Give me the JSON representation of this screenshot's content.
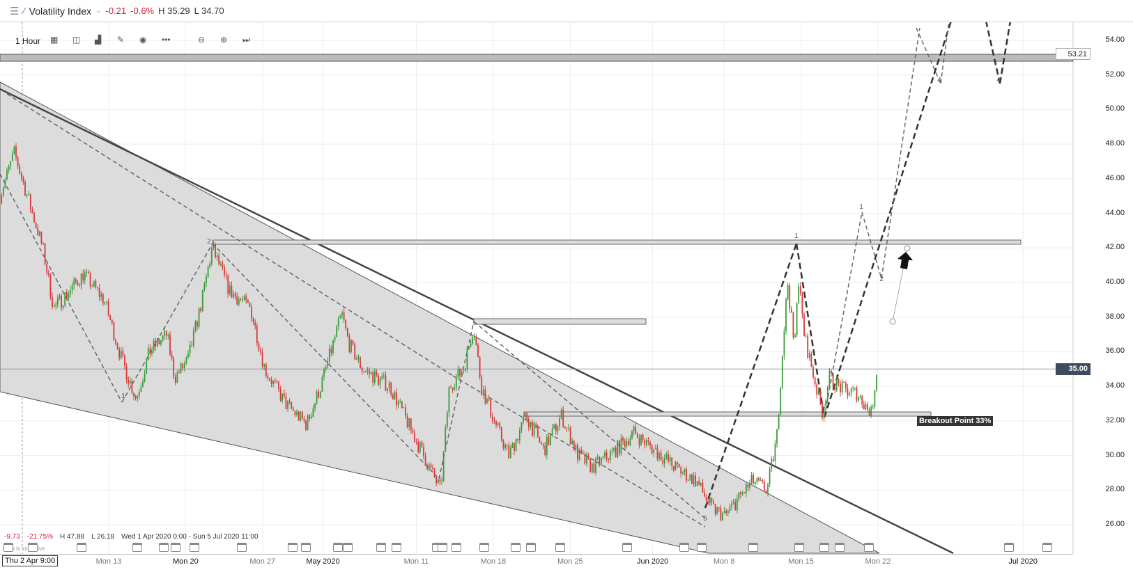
{
  "header": {
    "title": "Volatility Index",
    "change": "-0.21",
    "change_pct": "-0.6%",
    "high": "H 35.29",
    "low": "L 34.70"
  },
  "toolbar": {
    "interval": "1 Hour",
    "icons": [
      "calendar-grid-icon",
      "chart-type-icon",
      "bar-chart-icon",
      "pencil-icon",
      "eye-icon",
      "more-icon",
      "zoom-out-icon",
      "zoom-in-icon",
      "skip-to-end-icon"
    ]
  },
  "footer": {
    "change": "-9.73",
    "change_pct": "-21.75%",
    "high": "H 47.88",
    "low": "L 26.18",
    "range": "Wed 1 Apr 2020 0:00 - Sun 5 Jul 2020 11:00",
    "crosshair_date": "Thu 2 Apr 9:00",
    "disclaimer": "Data is indicative"
  },
  "colors": {
    "up": "#3a9b3a",
    "down": "#d9383a",
    "price_tag": "#3d4b5f"
  },
  "chart_data": {
    "type": "candlestick",
    "ylim": [
      25,
      55
    ],
    "yticks": [
      "54.00",
      "52.00",
      "50.00",
      "48.00",
      "46.00",
      "44.00",
      "42.00",
      "40.00",
      "38.00",
      "36.00",
      "34.00",
      "32.00",
      "30.00",
      "28.00",
      "26.00"
    ],
    "xticks": [
      {
        "d": "2020-04-13 00",
        "label": "Mon 13"
      },
      {
        "d": "2020-04-20 00",
        "label": "Mon 20"
      },
      {
        "d": "2020-04-27 00",
        "label": "Mon 27"
      },
      {
        "d": "2020-05-02 12",
        "label": "May 2020"
      },
      {
        "d": "2020-05-11 00",
        "label": "Mon 11"
      },
      {
        "d": "2020-05-18 00",
        "label": "Mon 18"
      },
      {
        "d": "2020-05-25 00",
        "label": "Mon 25"
      },
      {
        "d": "2020-06-01 12",
        "label": "Jun 2020"
      },
      {
        "d": "2020-06-08 00",
        "label": "Mon 8"
      },
      {
        "d": "2020-06-15 00",
        "label": "Mon 15"
      },
      {
        "d": "2020-06-22 00",
        "label": "Mon 22"
      },
      {
        "d": "2020-07-05 05",
        "label": "Jul 2020"
      }
    ],
    "price_path": [
      [
        "2020-04-03 02",
        45
      ],
      [
        "2020-04-04 10",
        47.5
      ],
      [
        "2020-04-07 00",
        42
      ],
      [
        "2020-04-08 00",
        38.5
      ],
      [
        "2020-04-09 10",
        39.5
      ],
      [
        "2020-04-10 17",
        40.5
      ],
      [
        "2020-04-12 14",
        39
      ],
      [
        "2020-04-14 05",
        35.5
      ],
      [
        "2020-04-15 12",
        33.3
      ],
      [
        "2020-04-16 17",
        36
      ],
      [
        "2020-04-18 07",
        37
      ],
      [
        "2020-04-19 00",
        34.5
      ],
      [
        "2020-04-20 05",
        35.5
      ],
      [
        "2020-04-21 12",
        39
      ],
      [
        "2020-04-22 10",
        42
      ],
      [
        "2020-04-24 00",
        39.5
      ],
      [
        "2020-04-25 22",
        38.5
      ],
      [
        "2020-04-27 05",
        35
      ],
      [
        "2020-04-29 02",
        33
      ],
      [
        "2020-05-01 00",
        31.8
      ],
      [
        "2020-05-02 07",
        34
      ],
      [
        "2020-05-03 05",
        36
      ],
      [
        "2020-05-04 05",
        38.2
      ],
      [
        "2020-05-04 20",
        36.5
      ],
      [
        "2020-05-06 02",
        35
      ],
      [
        "2020-05-08 14",
        34
      ],
      [
        "2020-05-10 12",
        31.5
      ],
      [
        "2020-05-12 10",
        29
      ],
      [
        "2020-05-13 05",
        28
      ],
      [
        "2020-05-14 00",
        34
      ],
      [
        "2020-05-15 07",
        35
      ],
      [
        "2020-05-16 05",
        37.5
      ],
      [
        "2020-05-16 22",
        34
      ],
      [
        "2020-05-18 02",
        32
      ],
      [
        "2020-05-19 10",
        30
      ],
      [
        "2020-05-21 00",
        32.3
      ],
      [
        "2020-05-22 14",
        30.3
      ],
      [
        "2020-05-24 05",
        32.3
      ],
      [
        "2020-05-25 17",
        30
      ],
      [
        "2020-05-27 00",
        29.3
      ],
      [
        "2020-05-28 22",
        30.2
      ],
      [
        "2020-05-30 19",
        31.3
      ],
      [
        "2020-06-01 17",
        30.3
      ],
      [
        "2020-06-03 14",
        29.3
      ],
      [
        "2020-06-05 12",
        28.5
      ],
      [
        "2020-06-06 19",
        27
      ],
      [
        "2020-06-08 02",
        26.5
      ],
      [
        "2020-06-09 07",
        27.5
      ],
      [
        "2020-06-10 14",
        28.5
      ],
      [
        "2020-06-11 22",
        28
      ],
      [
        "2020-06-12 19",
        31
      ],
      [
        "2020-06-13 10",
        37
      ],
      [
        "2020-06-13 19",
        40
      ],
      [
        "2020-06-14 10",
        36
      ],
      [
        "2020-06-14 17",
        40.5
      ],
      [
        "2020-06-15 07",
        37
      ],
      [
        "2020-06-16 00",
        35
      ],
      [
        "2020-06-16 22",
        32.5
      ],
      [
        "2020-06-17 14",
        34.5
      ],
      [
        "2020-06-18 19",
        33.8
      ],
      [
        "2020-06-20 02",
        33.6
      ],
      [
        "2020-06-21 10",
        32.4
      ],
      [
        "2020-06-21 22",
        35.1
      ]
    ],
    "last_price": "35.00",
    "level_tag": "53.21",
    "annotations": {
      "wave_labels": [
        "1",
        "2",
        "1",
        "1",
        "2",
        "4",
        "5",
        "4"
      ],
      "breakout_label": "Breakout Point 33%"
    }
  }
}
